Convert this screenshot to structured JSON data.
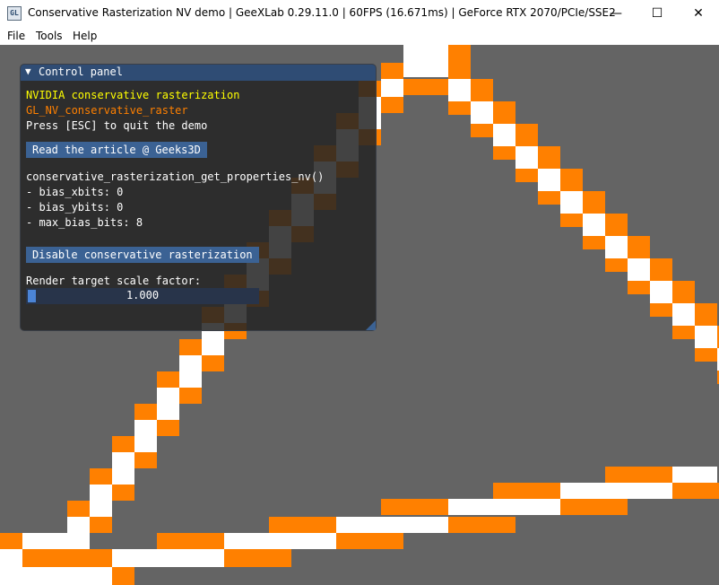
{
  "window": {
    "title": "Conservative Rasterization NV demo | GeeXLab 0.29.11.0 | 60FPS (16.671ms) | GeForce RTX 2070/PCIe/SSE2",
    "app_icon_text": "GL",
    "min_glyph": "—",
    "max_glyph": "☐",
    "close_glyph": "✕"
  },
  "menu": {
    "file": "File",
    "tools": "Tools",
    "help": "Help"
  },
  "panel": {
    "title": "Control panel",
    "collapse_glyph": "▼",
    "line_vendor": "NVIDIA conservative rasterization",
    "line_ext": "GL_NV_conservative_raster",
    "line_quit": "Press [ESC] to quit the demo",
    "article_button": "Read the article @ Geeks3D",
    "props_heading": "conservative_rasterization_get_properties_nv()",
    "bias_xbits": "- bias_xbits: 0",
    "bias_ybits": "- bias_ybits: 0",
    "max_bias_bits": "- max_bias_bits: 8",
    "toggle_button": "Disable conservative rasterization",
    "scale_label": "Render target scale factor:",
    "scale_value": "1.000"
  },
  "colors": {
    "viewport_bg": "#646464",
    "orange": "#ff8000",
    "white": "#ffffff",
    "panel_header": "#2f4c74",
    "button": "#3b6294",
    "vendor_text": "#ffff00",
    "ext_text": "#ff8000"
  }
}
